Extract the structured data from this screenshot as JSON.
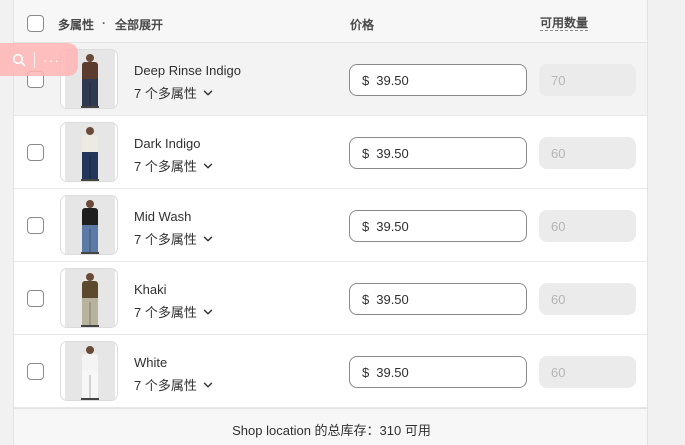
{
  "header": {
    "group_label": "多属性",
    "separator": "·",
    "expand_all_label": "全部展开",
    "price_label": "价格",
    "qty_label": "可用数量"
  },
  "rows": [
    {
      "name": "Deep Rinse Indigo",
      "variants": "7 个多属性",
      "currency": "$",
      "price": "39.50",
      "quantity": "70",
      "colors": {
        "top": "#5a3b2e",
        "pants": "#2f3a52"
      }
    },
    {
      "name": "Dark Indigo",
      "variants": "7 个多属性",
      "currency": "$",
      "price": "39.50",
      "quantity": "60",
      "colors": {
        "top": "#ede9e3",
        "pants": "#23355a"
      }
    },
    {
      "name": "Mid Wash",
      "variants": "7 个多属性",
      "currency": "$",
      "price": "39.50",
      "quantity": "60",
      "colors": {
        "top": "#1f1f1f",
        "pants": "#5b7ba6"
      }
    },
    {
      "name": "Khaki",
      "variants": "7 个多属性",
      "currency": "$",
      "price": "39.50",
      "quantity": "60",
      "colors": {
        "top": "#5c4a2e",
        "pants": "#b7b39d"
      }
    },
    {
      "name": "White",
      "variants": "7 个多属性",
      "currency": "$",
      "price": "39.50",
      "quantity": "60",
      "colors": {
        "top": "#f4f4f4",
        "pants": "#f7f7f7"
      }
    }
  ],
  "footer": {
    "text": "Shop location 的总库存：310 可用"
  },
  "toolbar": {
    "search_icon": "search-icon",
    "more_icon": "more-icon",
    "more_glyph": "···"
  },
  "colors": {
    "accent_border": "#8a8a8a",
    "disabled_bg": "#ebebeb",
    "disabled_text": "#b5b5b5"
  }
}
